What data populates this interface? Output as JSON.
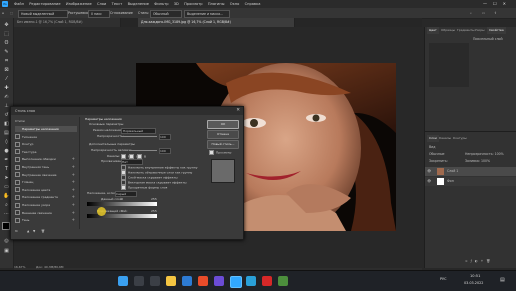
{
  "menubar": {
    "logo": "Ps",
    "items": [
      "Файл",
      "Редактирование",
      "Изображение",
      "Слои",
      "Текст",
      "Выделение",
      "Фильтр",
      "3D",
      "Просмотр",
      "Плагины",
      "Окно",
      "Справка"
    ]
  },
  "options": {
    "mode": "Новый выделенный",
    "feather_label": "Растушевка:",
    "feather_value": "0 пикс",
    "antialias": "Сглаживание",
    "style_label": "Стиль:",
    "style_value": "Обычный",
    "select_mask": "Выделение и маска..."
  },
  "tabs": [
    {
      "label": "Без имени-1 @ 16,7% (Слой 1, RGB/8#)",
      "active": false
    },
    {
      "label": "Для-каждого-IMG_3189.jpg @ 16,7% (Слой 1, RGB/8#)",
      "active": true
    }
  ],
  "right_panel": {
    "top_tabs": [
      "Цвет",
      "Образцы",
      "Градиенты",
      "Узоры"
    ],
    "right_tabs": [
      "Свойства",
      "Коррекция",
      "Библиотеки"
    ],
    "props_title": "Пиксельный слой",
    "layers_tabs": [
      "Слои",
      "Каналы",
      "Контуры"
    ],
    "kind_label": "Вид",
    "blend": "Обычные",
    "opacity": "Непрозрачность: 100%",
    "lock": "Закрепить:",
    "fill": "Заливка: 100%",
    "layers": [
      {
        "name": "Слой 1"
      },
      {
        "name": "Фон"
      }
    ]
  },
  "dialog": {
    "title": "Стиль слоя",
    "section_left": "Стили",
    "styles": [
      {
        "label": "Параметры наложения",
        "checked": false,
        "selected": true
      },
      {
        "label": "Тиснение",
        "checked": false
      },
      {
        "label": "Контур",
        "checked": false
      },
      {
        "label": "Текстура",
        "checked": false
      },
      {
        "label": "Выполнение обводки",
        "checked": false
      },
      {
        "label": "Внутренняя тень",
        "checked": false
      },
      {
        "label": "Внутреннее свечение",
        "checked": false
      },
      {
        "label": "Глянец",
        "checked": false
      },
      {
        "label": "Наложение цвета",
        "checked": false
      },
      {
        "label": "Наложение градиента",
        "checked": false
      },
      {
        "label": "Наложение узора",
        "checked": false
      },
      {
        "label": "Внешнее свечение",
        "checked": false
      },
      {
        "label": "Тень",
        "checked": false
      }
    ],
    "fx_label": "fx",
    "group_title": "Параметры наложения",
    "subgroup": "Основные параметры",
    "blend_mode_label": "Режим наложения:",
    "blend_mode_value": "Нормальный",
    "opacity_label": "Непрозрачность:",
    "opacity_value": "100",
    "extended": "Дополнительные параметры",
    "fill_opacity_label": "Непрозрачность заливки:",
    "fill_opacity_value": "100",
    "channels_label": "Каналы:",
    "channels": [
      "R",
      "G",
      "B"
    ],
    "knockout_label": "Просвечивание:",
    "knockout_value": "Нет",
    "checks": [
      "Наложить внутренние эффекты как группу",
      "Наложить обтравочные слои как группу",
      "Слой-маска скрывает эффекты",
      "Векторная маска скрывает эффекты",
      "Прозрачные формы слоя"
    ],
    "blend_if_label": "Наложение, если:",
    "blend_if_value": "Серый",
    "this_layer": "Данный слой:",
    "this_layer_values": [
      "0",
      "255"
    ],
    "underlying": "Подлежащий слой:",
    "underlying_values": [
      "0",
      "255"
    ],
    "buttons": {
      "ok": "ОК",
      "cancel": "Отмена",
      "new_style": "Новый стиль...",
      "preview": "Просмотр"
    }
  },
  "status": {
    "zoom": "16,67%",
    "doc": "Док: 40,3M/80,6M"
  },
  "taskbar": {
    "lang": "РУС",
    "time": "10:51",
    "date": "03.03.2022"
  },
  "colors": {
    "accent": "#31a8ff",
    "panel": "#323232",
    "dialog": "#3a3a3a",
    "taskbar": "#1f2227"
  }
}
